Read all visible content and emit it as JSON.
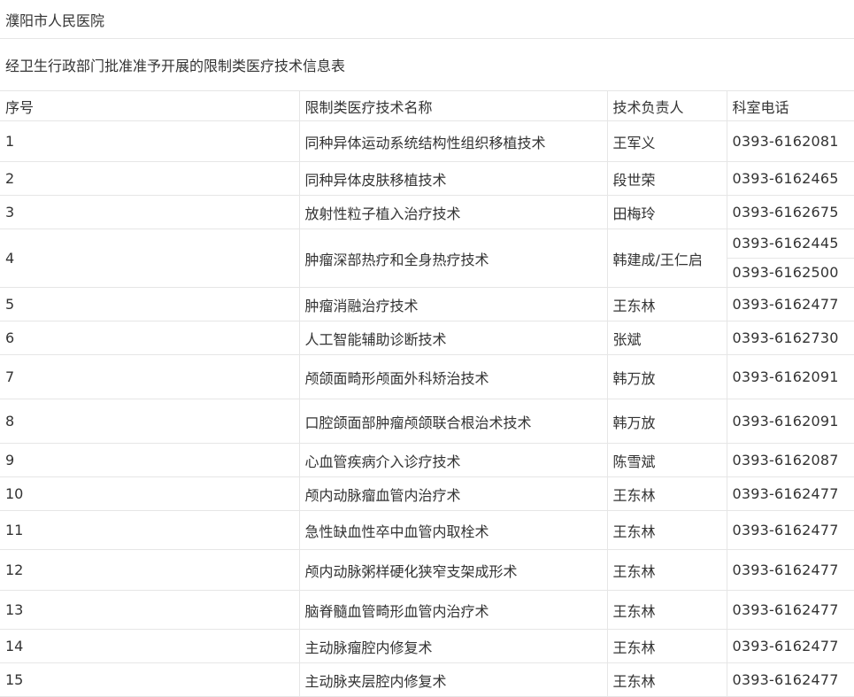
{
  "hospital": "濮阳市人民医院",
  "table_title": "经卫生行政部门批准准予开展的限制类医疗技术信息表",
  "headers": {
    "no": "序号",
    "name": "限制类医疗技术名称",
    "lead": "技术负责人",
    "phone": "科室电话"
  },
  "rows": [
    {
      "no": "1",
      "name": "同种异体运动系统结构性组织移植技术",
      "lead": "王军义",
      "phone": "0393-6162081"
    },
    {
      "no": "2",
      "name": "同种异体皮肤移植技术",
      "lead": "段世荣",
      "phone": "0393-6162465"
    },
    {
      "no": "3",
      "name": "放射性粒子植入治疗技术",
      "lead": "田梅玲",
      "phone": "0393-6162675"
    },
    {
      "no": "4",
      "name": "肿瘤深部热疗和全身热疗技术",
      "lead": "韩建成/王仁启",
      "phone": "0393-6162445",
      "phone2": "0393-6162500"
    },
    {
      "no": "5",
      "name": "肿瘤消融治疗技术",
      "lead": "王东林",
      "phone": "0393-6162477"
    },
    {
      "no": "6",
      "name": "人工智能辅助诊断技术",
      "lead": "张斌",
      "phone": "0393-6162730"
    },
    {
      "no": "7",
      "name": "颅颌面畸形颅面外科矫治技术",
      "lead": "韩万放",
      "phone": "0393-6162091"
    },
    {
      "no": "8",
      "name": "口腔颌面部肿瘤颅颌联合根治术技术",
      "lead": "韩万放",
      "phone": "0393-6162091"
    },
    {
      "no": "9",
      "name": "心血管疾病介入诊疗技术",
      "lead": "陈雪斌",
      "phone": "0393-6162087"
    },
    {
      "no": "10",
      "name": "颅内动脉瘤血管内治疗术",
      "lead": "王东林",
      "phone": "0393-6162477"
    },
    {
      "no": "11",
      "name": "急性缺血性卒中血管内取栓术",
      "lead": "王东林",
      "phone": "0393-6162477"
    },
    {
      "no": "12",
      "name": "颅内动脉粥样硬化狭窄支架成形术",
      "lead": "王东林",
      "phone": "0393-6162477"
    },
    {
      "no": "13",
      "name": "脑脊髓血管畸形血管内治疗术",
      "lead": "王东林",
      "phone": "0393-6162477"
    },
    {
      "no": "14",
      "name": "主动脉瘤腔内修复术",
      "lead": "王东林",
      "phone": "0393-6162477"
    },
    {
      "no": "15",
      "name": "主动脉夹层腔内修复术",
      "lead": "王东林",
      "phone": "0393-6162477"
    }
  ]
}
